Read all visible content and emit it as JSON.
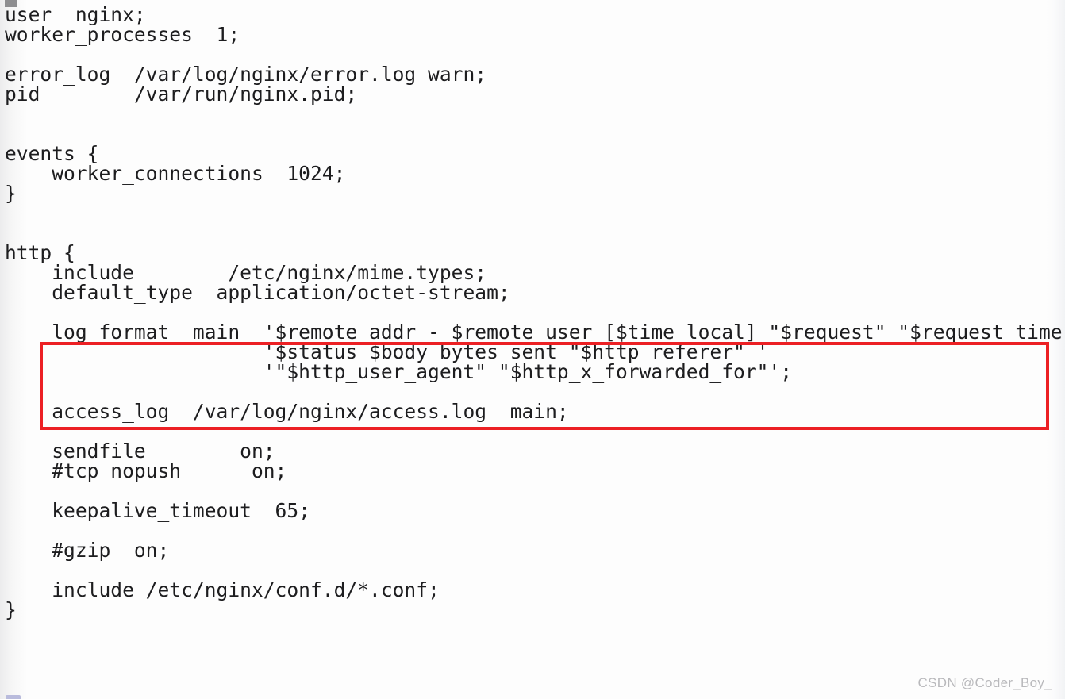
{
  "document": {
    "kind": "code-screenshot",
    "language": "nginx-conf",
    "background_color": "#fdfdfd",
    "text_color": "#1d1d1f"
  },
  "code": {
    "lines": [
      "user  nginx;",
      "worker_processes  1;",
      "",
      "error_log  /var/log/nginx/error.log warn;",
      "pid        /var/run/nginx.pid;",
      "",
      "",
      "events {",
      "    worker_connections  1024;",
      "}",
      "",
      "",
      "http {",
      "    include        /etc/nginx/mime.types;",
      "    default_type  application/octet-stream;",
      "",
      "    log_format  main  '$remote_addr - $remote_user [$time_local] \"$request\" \"$request_time\"  '",
      "                      '$status $body_bytes_sent \"$http_referer\" '",
      "                      '\"$http_user_agent\" \"$http_x_forwarded_for\"';",
      "",
      "    access_log  /var/log/nginx/access.log  main;",
      "",
      "    sendfile        on;",
      "    #tcp_nopush      on;",
      "",
      "    keepalive_timeout  65;",
      "",
      "    #gzip  on;",
      "",
      "    include /etc/nginx/conf.d/*.conf;",
      "}"
    ]
  },
  "annotation": {
    "name": "log-format-highlight",
    "color": "#ec2024",
    "border_width_px": 4,
    "covers_lines": [
      "log_format  main  '$remote_addr - $remote_user [$time_local] \"$request\" \"$request_time\"  '",
      "'$status $body_bytes_sent \"$http_referer\" '",
      "'\"$http_user_agent\" \"$http_x_forwarded_for\"';"
    ]
  },
  "watermark": {
    "text": "CSDN @Coder_Boy_",
    "color": "#b9b9bc"
  }
}
